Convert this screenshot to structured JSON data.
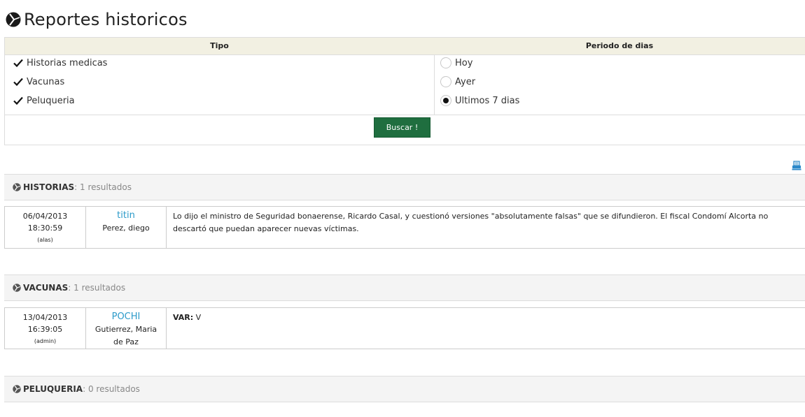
{
  "page": {
    "title": "Reportes historicos"
  },
  "filter": {
    "tipo_header": "Tipo",
    "periodo_header": "Periodo de dias",
    "tipos": [
      {
        "label": "Historias medicas",
        "checked": true
      },
      {
        "label": "Vacunas",
        "checked": true
      },
      {
        "label": "Peluqueria",
        "checked": true
      }
    ],
    "periodos": [
      {
        "label": "Hoy",
        "selected": false
      },
      {
        "label": "Ayer",
        "selected": false
      },
      {
        "label": "Ultimos 7 dias",
        "selected": true
      }
    ],
    "search_button": "Buscar !"
  },
  "accent": {
    "button": "#1f6e3f",
    "pet_link": "#2b9ac9",
    "print_icon": "#2b88c9"
  },
  "sections": [
    {
      "name": "HISTORIAS",
      "count_text": ": 1 resultados",
      "results": [
        {
          "date": "06/04/2013",
          "time": "18:30:59",
          "user": "(alas)",
          "pet": "titin",
          "owner": "Perez, diego",
          "detail_label": "",
          "detail": "Lo dijo el ministro de Seguridad bonaerense, Ricardo Casal, y cuestionó versiones \"absolutamente falsas\" que se difundieron. El fiscal Condomí Alcorta no descartó que puedan aparecer nuevas víctimas."
        }
      ]
    },
    {
      "name": "VACUNAS",
      "count_text": ": 1 resultados",
      "results": [
        {
          "date": "13/04/2013",
          "time": "16:39:05",
          "user": "(admin)",
          "pet": "POCHI",
          "owner": "Gutierrez, Maria de Paz",
          "detail_label": "VAR:",
          "detail": " V"
        }
      ]
    },
    {
      "name": "PELUQUERIA",
      "count_text": ": 0 resultados",
      "results": []
    }
  ]
}
